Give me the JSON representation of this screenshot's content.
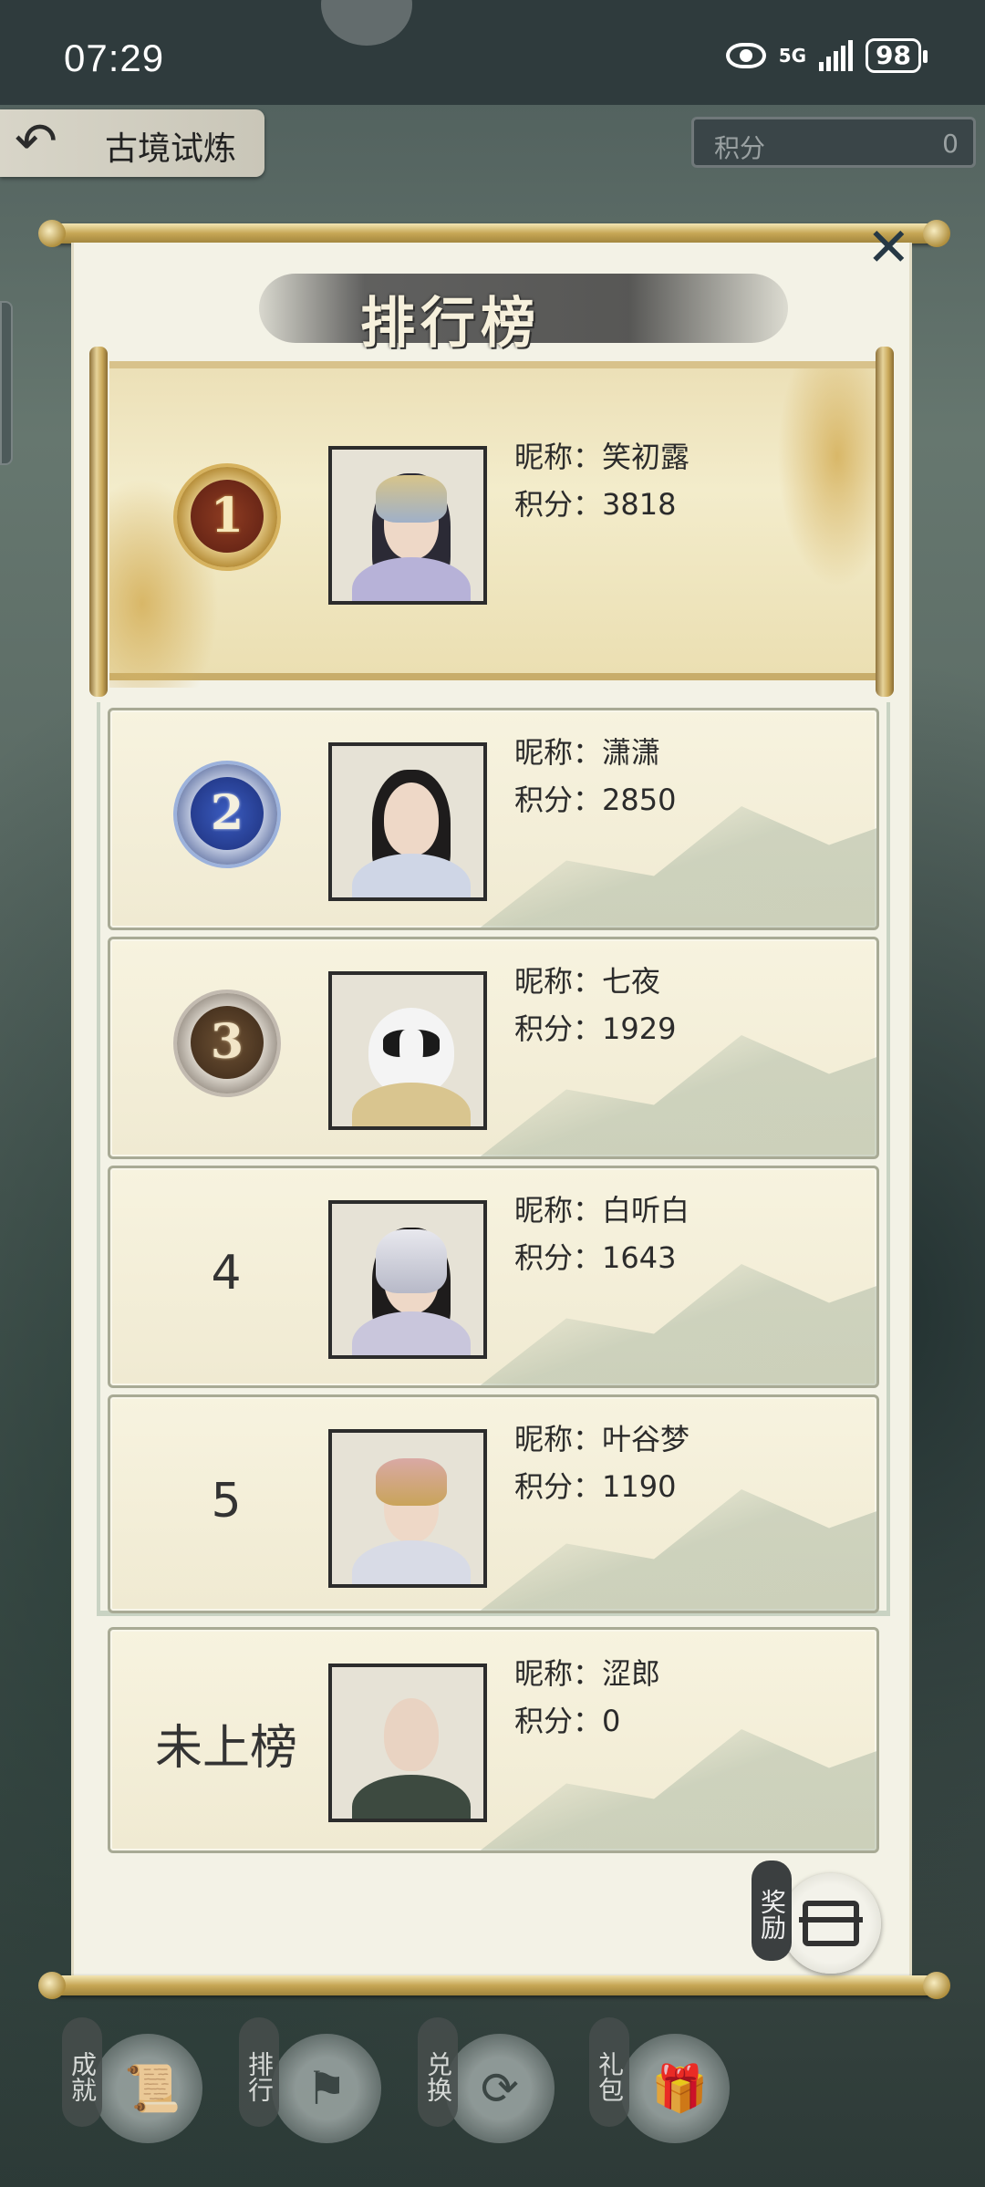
{
  "status_bar": {
    "time": "07:29",
    "network": "5G",
    "battery": "98"
  },
  "header": {
    "title": "古境试炼",
    "score_label": "积分",
    "score_value": "0"
  },
  "panel": {
    "title": "排行榜",
    "nick_prefix": "昵称：",
    "score_prefix": "积分："
  },
  "rankings": [
    {
      "rank": "1",
      "nickname": "笑初露",
      "score": "3818"
    },
    {
      "rank": "2",
      "nickname": "潇潇",
      "score": "2850"
    },
    {
      "rank": "3",
      "nickname": "七夜",
      "score": "1929"
    },
    {
      "rank": "4",
      "nickname": "白听白",
      "score": "1643"
    },
    {
      "rank": "5",
      "nickname": "叶谷梦",
      "score": "1190"
    }
  ],
  "self": {
    "rank": "未上榜",
    "nickname": "涩郎",
    "score": "0"
  },
  "reward_button": {
    "label": "奖励",
    "icon": "treasure-chest-icon"
  },
  "bottom_nav": [
    {
      "label": "成就",
      "icon": "scroll-icon"
    },
    {
      "label": "排行",
      "icon": "banner-icon"
    },
    {
      "label": "兑换",
      "icon": "exchange-icon"
    },
    {
      "label": "礼包",
      "icon": "gift-icon"
    }
  ],
  "colors": {
    "gold": "#d6b25e",
    "silver_blue": "#3b5cc0",
    "bronze": "#6d5134",
    "card_bg": "#f3eecf"
  }
}
